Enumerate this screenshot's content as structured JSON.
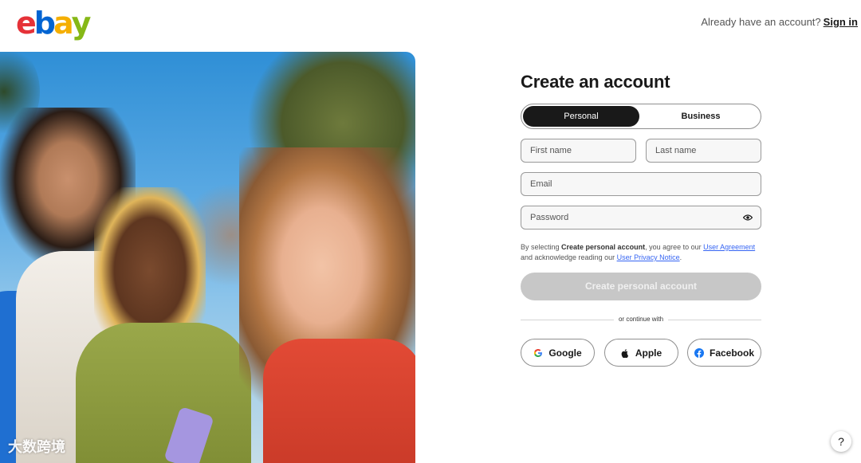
{
  "brand": {
    "logo_letters": [
      "e",
      "b",
      "a",
      "y"
    ],
    "logo_colors": [
      "#e53238",
      "#0064d2",
      "#f5af02",
      "#86b817"
    ]
  },
  "header": {
    "prompt": "Already have an account?",
    "signin_label": "Sign in"
  },
  "form": {
    "title": "Create an account",
    "account_types": [
      "Personal",
      "Business"
    ],
    "selected_type": "Personal",
    "first_name_placeholder": "First name",
    "last_name_placeholder": "Last name",
    "email_placeholder": "Email",
    "password_placeholder": "Password",
    "legal": {
      "prefix": "By selecting ",
      "bold": "Create personal account",
      "middle": ", you agree to our ",
      "link1": "User Agreement",
      "middle2": " and acknowledge reading our ",
      "link2": "User Privacy Notice",
      "suffix": "."
    },
    "submit_label": "Create personal account",
    "divider_text": "or continue with",
    "social": [
      "Google",
      "Apple",
      "Facebook"
    ]
  },
  "help_label": "?",
  "watermark": "大数跨境",
  "colors": {
    "link": "#3665f3",
    "button_disabled": "#c7c7c7",
    "dark": "#191919"
  }
}
